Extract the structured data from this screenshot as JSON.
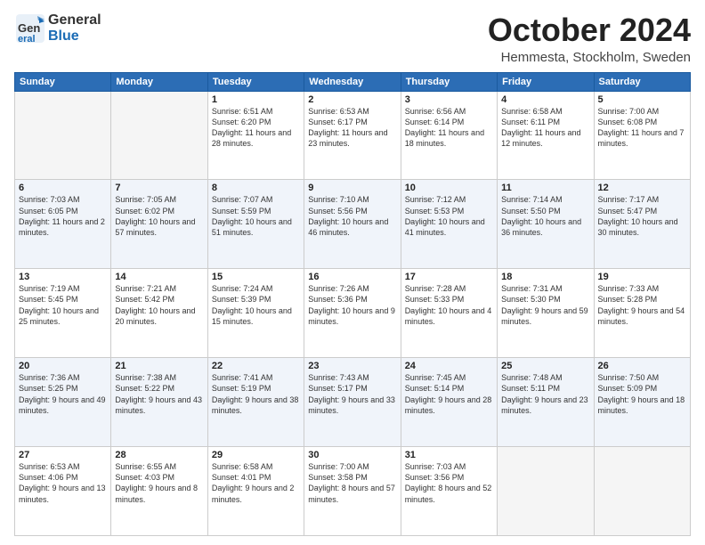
{
  "header": {
    "logo_general": "General",
    "logo_blue": "Blue",
    "month_title": "October 2024",
    "location": "Hemmesta, Stockholm, Sweden"
  },
  "weekdays": [
    "Sunday",
    "Monday",
    "Tuesday",
    "Wednesday",
    "Thursday",
    "Friday",
    "Saturday"
  ],
  "rows": [
    [
      {
        "day": "",
        "sunrise": "",
        "sunset": "",
        "daylight": ""
      },
      {
        "day": "",
        "sunrise": "",
        "sunset": "",
        "daylight": ""
      },
      {
        "day": "1",
        "sunrise": "Sunrise: 6:51 AM",
        "sunset": "Sunset: 6:20 PM",
        "daylight": "Daylight: 11 hours and 28 minutes."
      },
      {
        "day": "2",
        "sunrise": "Sunrise: 6:53 AM",
        "sunset": "Sunset: 6:17 PM",
        "daylight": "Daylight: 11 hours and 23 minutes."
      },
      {
        "day": "3",
        "sunrise": "Sunrise: 6:56 AM",
        "sunset": "Sunset: 6:14 PM",
        "daylight": "Daylight: 11 hours and 18 minutes."
      },
      {
        "day": "4",
        "sunrise": "Sunrise: 6:58 AM",
        "sunset": "Sunset: 6:11 PM",
        "daylight": "Daylight: 11 hours and 12 minutes."
      },
      {
        "day": "5",
        "sunrise": "Sunrise: 7:00 AM",
        "sunset": "Sunset: 6:08 PM",
        "daylight": "Daylight: 11 hours and 7 minutes."
      }
    ],
    [
      {
        "day": "6",
        "sunrise": "Sunrise: 7:03 AM",
        "sunset": "Sunset: 6:05 PM",
        "daylight": "Daylight: 11 hours and 2 minutes."
      },
      {
        "day": "7",
        "sunrise": "Sunrise: 7:05 AM",
        "sunset": "Sunset: 6:02 PM",
        "daylight": "Daylight: 10 hours and 57 minutes."
      },
      {
        "day": "8",
        "sunrise": "Sunrise: 7:07 AM",
        "sunset": "Sunset: 5:59 PM",
        "daylight": "Daylight: 10 hours and 51 minutes."
      },
      {
        "day": "9",
        "sunrise": "Sunrise: 7:10 AM",
        "sunset": "Sunset: 5:56 PM",
        "daylight": "Daylight: 10 hours and 46 minutes."
      },
      {
        "day": "10",
        "sunrise": "Sunrise: 7:12 AM",
        "sunset": "Sunset: 5:53 PM",
        "daylight": "Daylight: 10 hours and 41 minutes."
      },
      {
        "day": "11",
        "sunrise": "Sunrise: 7:14 AM",
        "sunset": "Sunset: 5:50 PM",
        "daylight": "Daylight: 10 hours and 36 minutes."
      },
      {
        "day": "12",
        "sunrise": "Sunrise: 7:17 AM",
        "sunset": "Sunset: 5:47 PM",
        "daylight": "Daylight: 10 hours and 30 minutes."
      }
    ],
    [
      {
        "day": "13",
        "sunrise": "Sunrise: 7:19 AM",
        "sunset": "Sunset: 5:45 PM",
        "daylight": "Daylight: 10 hours and 25 minutes."
      },
      {
        "day": "14",
        "sunrise": "Sunrise: 7:21 AM",
        "sunset": "Sunset: 5:42 PM",
        "daylight": "Daylight: 10 hours and 20 minutes."
      },
      {
        "day": "15",
        "sunrise": "Sunrise: 7:24 AM",
        "sunset": "Sunset: 5:39 PM",
        "daylight": "Daylight: 10 hours and 15 minutes."
      },
      {
        "day": "16",
        "sunrise": "Sunrise: 7:26 AM",
        "sunset": "Sunset: 5:36 PM",
        "daylight": "Daylight: 10 hours and 9 minutes."
      },
      {
        "day": "17",
        "sunrise": "Sunrise: 7:28 AM",
        "sunset": "Sunset: 5:33 PM",
        "daylight": "Daylight: 10 hours and 4 minutes."
      },
      {
        "day": "18",
        "sunrise": "Sunrise: 7:31 AM",
        "sunset": "Sunset: 5:30 PM",
        "daylight": "Daylight: 9 hours and 59 minutes."
      },
      {
        "day": "19",
        "sunrise": "Sunrise: 7:33 AM",
        "sunset": "Sunset: 5:28 PM",
        "daylight": "Daylight: 9 hours and 54 minutes."
      }
    ],
    [
      {
        "day": "20",
        "sunrise": "Sunrise: 7:36 AM",
        "sunset": "Sunset: 5:25 PM",
        "daylight": "Daylight: 9 hours and 49 minutes."
      },
      {
        "day": "21",
        "sunrise": "Sunrise: 7:38 AM",
        "sunset": "Sunset: 5:22 PM",
        "daylight": "Daylight: 9 hours and 43 minutes."
      },
      {
        "day": "22",
        "sunrise": "Sunrise: 7:41 AM",
        "sunset": "Sunset: 5:19 PM",
        "daylight": "Daylight: 9 hours and 38 minutes."
      },
      {
        "day": "23",
        "sunrise": "Sunrise: 7:43 AM",
        "sunset": "Sunset: 5:17 PM",
        "daylight": "Daylight: 9 hours and 33 minutes."
      },
      {
        "day": "24",
        "sunrise": "Sunrise: 7:45 AM",
        "sunset": "Sunset: 5:14 PM",
        "daylight": "Daylight: 9 hours and 28 minutes."
      },
      {
        "day": "25",
        "sunrise": "Sunrise: 7:48 AM",
        "sunset": "Sunset: 5:11 PM",
        "daylight": "Daylight: 9 hours and 23 minutes."
      },
      {
        "day": "26",
        "sunrise": "Sunrise: 7:50 AM",
        "sunset": "Sunset: 5:09 PM",
        "daylight": "Daylight: 9 hours and 18 minutes."
      }
    ],
    [
      {
        "day": "27",
        "sunrise": "Sunrise: 6:53 AM",
        "sunset": "Sunset: 4:06 PM",
        "daylight": "Daylight: 9 hours and 13 minutes."
      },
      {
        "day": "28",
        "sunrise": "Sunrise: 6:55 AM",
        "sunset": "Sunset: 4:03 PM",
        "daylight": "Daylight: 9 hours and 8 minutes."
      },
      {
        "day": "29",
        "sunrise": "Sunrise: 6:58 AM",
        "sunset": "Sunset: 4:01 PM",
        "daylight": "Daylight: 9 hours and 2 minutes."
      },
      {
        "day": "30",
        "sunrise": "Sunrise: 7:00 AM",
        "sunset": "Sunset: 3:58 PM",
        "daylight": "Daylight: 8 hours and 57 minutes."
      },
      {
        "day": "31",
        "sunrise": "Sunrise: 7:03 AM",
        "sunset": "Sunset: 3:56 PM",
        "daylight": "Daylight: 8 hours and 52 minutes."
      },
      {
        "day": "",
        "sunrise": "",
        "sunset": "",
        "daylight": ""
      },
      {
        "day": "",
        "sunrise": "",
        "sunset": "",
        "daylight": ""
      }
    ]
  ]
}
